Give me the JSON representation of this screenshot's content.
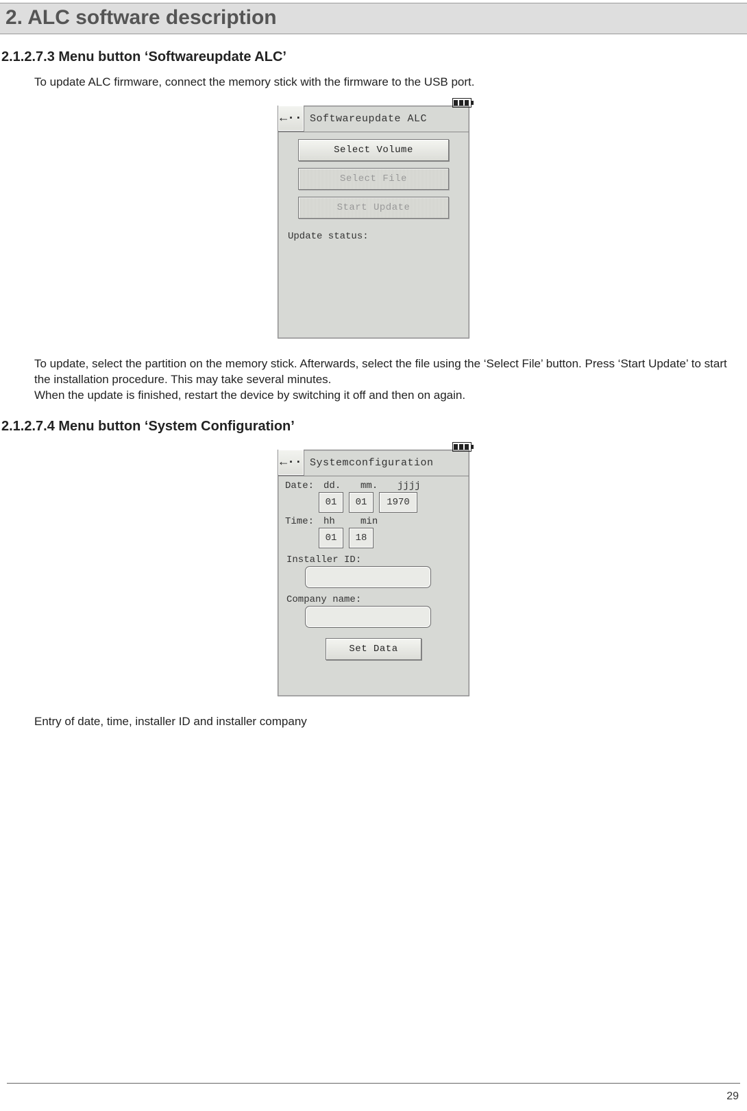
{
  "page": {
    "title": "2. ALC software description",
    "number": "29"
  },
  "section1": {
    "heading": "2.1.2.7.3 Menu button ‘Softwareupdate ALC’",
    "intro": "To update ALC firmware, connect the memory stick with the firmware to the USB port.",
    "outro": "To update, select the partition on the memory stick. Afterwards, select the file using the ‘Select File’ button. Press ‘Start Update’ to start the installation procedure. This may take several minutes.\nWhen the update is finished, restart the device by switching it off and then on again.",
    "device": {
      "title": "Softwareupdate ALC",
      "back_symbol": "←··",
      "buttons": [
        {
          "label": "Select Volume",
          "enabled": true
        },
        {
          "label": "Select File",
          "enabled": false
        },
        {
          "label": "Start Update",
          "enabled": false
        }
      ],
      "status_label": "Update status:"
    }
  },
  "section2": {
    "heading": "2.1.2.7.4 Menu button ‘System Configuration’",
    "caption": "Entry of date, time, installer ID and installer company",
    "device": {
      "title": "Systemconfiguration",
      "back_symbol": "←··",
      "date": {
        "label": "Date:",
        "cols": {
          "dd": "dd.",
          "mm": "mm.",
          "jjjj": "jjjj"
        },
        "values": {
          "dd": "01",
          "mm": "01",
          "jjjj": "1970"
        }
      },
      "time": {
        "label": "Time:",
        "cols": {
          "hh": "hh",
          "min": "min"
        },
        "values": {
          "hh": "01",
          "min": "18"
        }
      },
      "installer_label": "Installer ID:",
      "company_label": "Company name:",
      "set_button": "Set Data"
    }
  }
}
